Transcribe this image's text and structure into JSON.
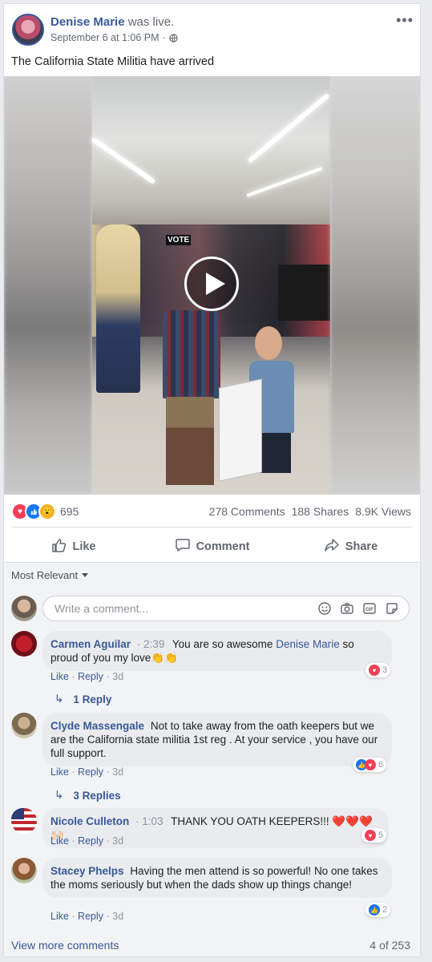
{
  "post": {
    "author": "Denise Marie",
    "action": "was live.",
    "date": "September 6 at 1:06 PM",
    "separator": "·",
    "text": "The California State Militia have arrived",
    "more_icon": "more-options-icon",
    "privacy_icon": "globe-icon"
  },
  "video": {
    "play_icon": "play-icon",
    "overlay_text": "VOTE"
  },
  "stats": {
    "reaction_count": "695",
    "reaction_types": [
      "love",
      "like",
      "wow"
    ],
    "comments": "278 Comments",
    "shares": "188 Shares",
    "views": "8.9K Views"
  },
  "actions": {
    "like": "Like",
    "comment": "Comment",
    "share": "Share"
  },
  "sort": {
    "label": "Most Relevant"
  },
  "composer": {
    "placeholder": "Write a comment..."
  },
  "comments": [
    {
      "name": "Carmen Aguilar",
      "time": "2:39",
      "text_a": "You are so awesome ",
      "mention": "Denise Marie",
      "text_b": " so proud of you my love👏👏",
      "like": "Like",
      "reply": "Reply",
      "age": "3d",
      "reaction_count": "3",
      "replies": "1 Reply"
    },
    {
      "name": "Clyde Massengale",
      "text": "Not to take away from the oath keepers but we are the California state militia 1st reg . At your service , you have our full support.",
      "like": "Like",
      "reply": "Reply",
      "age": "3d",
      "reaction_count": "6",
      "replies": "3 Replies"
    },
    {
      "name": "Nicole Culleton",
      "time": "1:03",
      "text": "THANK YOU OATH KEEPERS!!! ❤️❤️❤️🙌🏻",
      "like": "Like",
      "reply": "Reply",
      "age": "3d",
      "reaction_count": "5"
    },
    {
      "name": "Stacey Phelps",
      "text": "Having the men attend is so powerful! No one takes the moms seriously but when the dads show up things change!",
      "like": "Like",
      "reply": "Reply",
      "age": "3d",
      "reaction_count": "2"
    }
  ],
  "footer": {
    "view_more": "View more comments",
    "pager": "4 of 253"
  },
  "colors": {
    "link": "#385898",
    "love": "#f33e58",
    "like": "#1877f2",
    "muted": "#606770"
  }
}
